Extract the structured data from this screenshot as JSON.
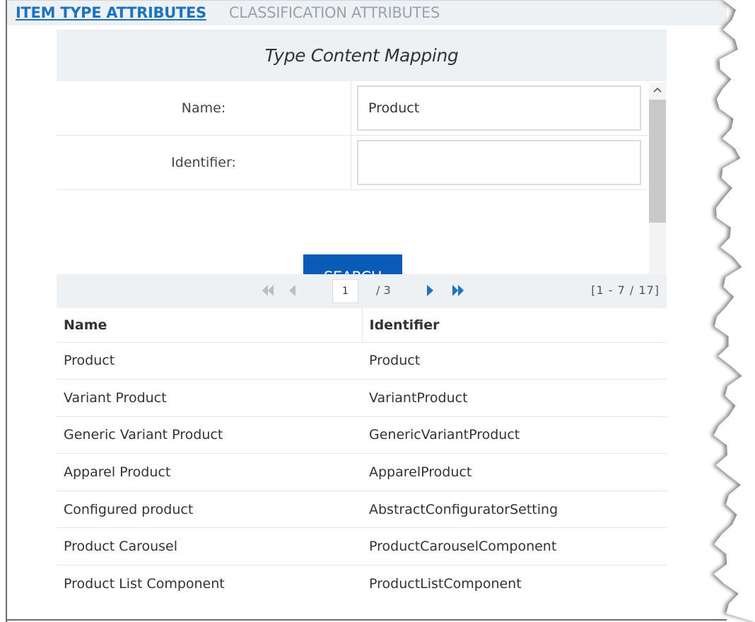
{
  "tabs": {
    "item_type": "ITEM TYPE ATTRIBUTES",
    "classification": "CLASSIFICATION ATTRIBUTES"
  },
  "panel": {
    "title": "Type Content Mapping",
    "name_label": "Name:",
    "name_value": "Product",
    "identifier_label": "Identifier:",
    "identifier_value": "",
    "search_label": "SEARCH"
  },
  "pager": {
    "current_page": "1",
    "total": "/ 3",
    "range": "[1 - 7 / 17]"
  },
  "table": {
    "headers": [
      "Name",
      "Identifier"
    ],
    "rows": [
      [
        "Product",
        "Product"
      ],
      [
        "Variant Product",
        "VariantProduct"
      ],
      [
        "Generic Variant Product",
        "GenericVariantProduct"
      ],
      [
        "Apparel Product",
        "ApparelProduct"
      ],
      [
        "Configured product",
        "AbstractConfiguratorSetting"
      ],
      [
        "Product Carousel",
        "ProductCarouselComponent"
      ],
      [
        "Product List Component",
        "ProductListComponent"
      ]
    ]
  },
  "colors": {
    "accent": "#1e73be",
    "button": "#0a5bb8",
    "header_bg": "#eef1f4"
  }
}
